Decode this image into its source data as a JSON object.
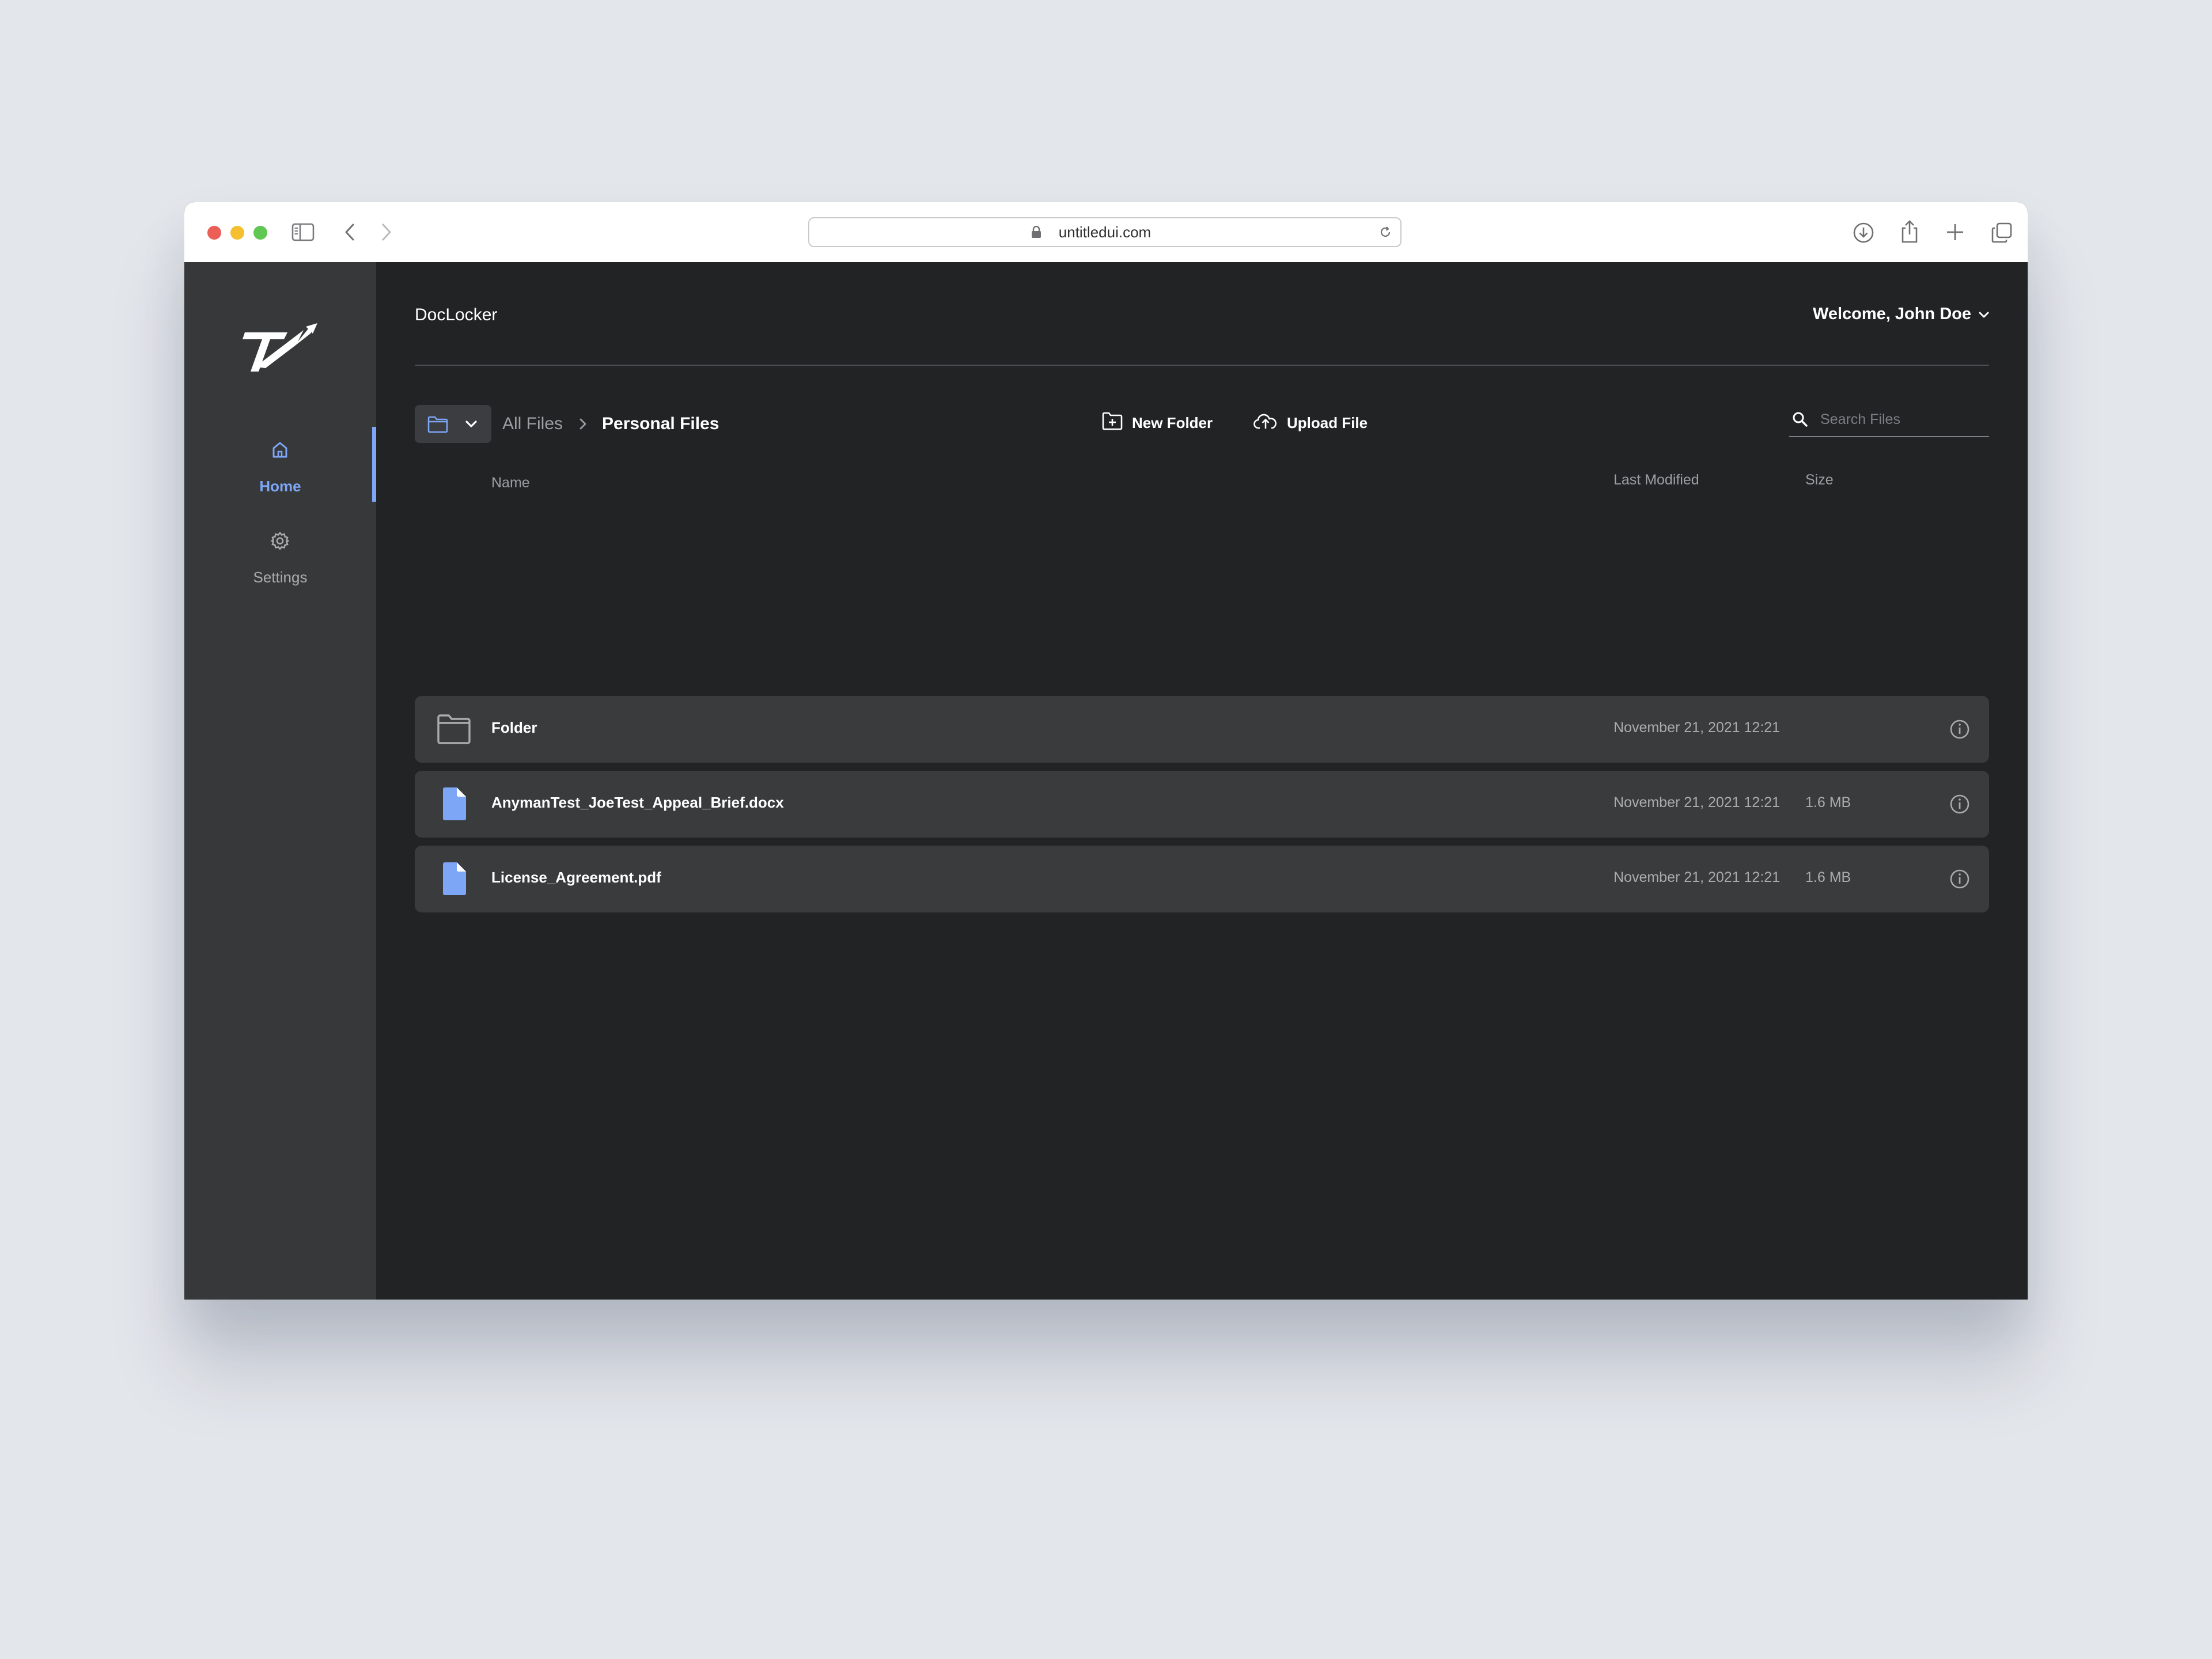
{
  "browser": {
    "url": "untitledui.com",
    "icons": [
      "sidebar-toggle-icon",
      "back-arrow-icon",
      "forward-arrow-icon",
      "privacy-shield-icon",
      "lock-icon",
      "reload-icon",
      "download-icon",
      "share-icon",
      "new-tab-plus-icon",
      "tab-overview-icon"
    ]
  },
  "sidebar": {
    "items": [
      {
        "label": "Home",
        "icon": "home-icon",
        "active": true
      },
      {
        "label": "Settings",
        "icon": "gear-icon",
        "active": false
      }
    ]
  },
  "header": {
    "app_title": "DocLocker",
    "welcome": "Welcome, John Doe"
  },
  "breadcrumb": {
    "root": "All Files",
    "current": "Personal Files"
  },
  "actions": {
    "new_folder": "New Folder",
    "upload_file": "Upload File"
  },
  "search": {
    "placeholder": "Search Files",
    "value": ""
  },
  "table": {
    "columns": {
      "name": "Name",
      "modified": "Last Modified",
      "size": "Size"
    },
    "rows": [
      {
        "type": "folder",
        "name": "Folder",
        "modified": "November 21, 2021 12:21",
        "size": ""
      },
      {
        "type": "file",
        "name": "AnymanTest_JoeTest_Appeal_Brief.docx",
        "modified": "November 21, 2021 12:21",
        "size": "1.6 MB"
      },
      {
        "type": "file",
        "name": "License_Agreement.pdf",
        "modified": "November 21, 2021 12:21",
        "size": "1.6 MB"
      }
    ]
  },
  "colors": {
    "accent": "#7ea6f6",
    "sidebar_bg": "#363839",
    "main_bg": "#222325",
    "row_bg": "#393b3d"
  }
}
